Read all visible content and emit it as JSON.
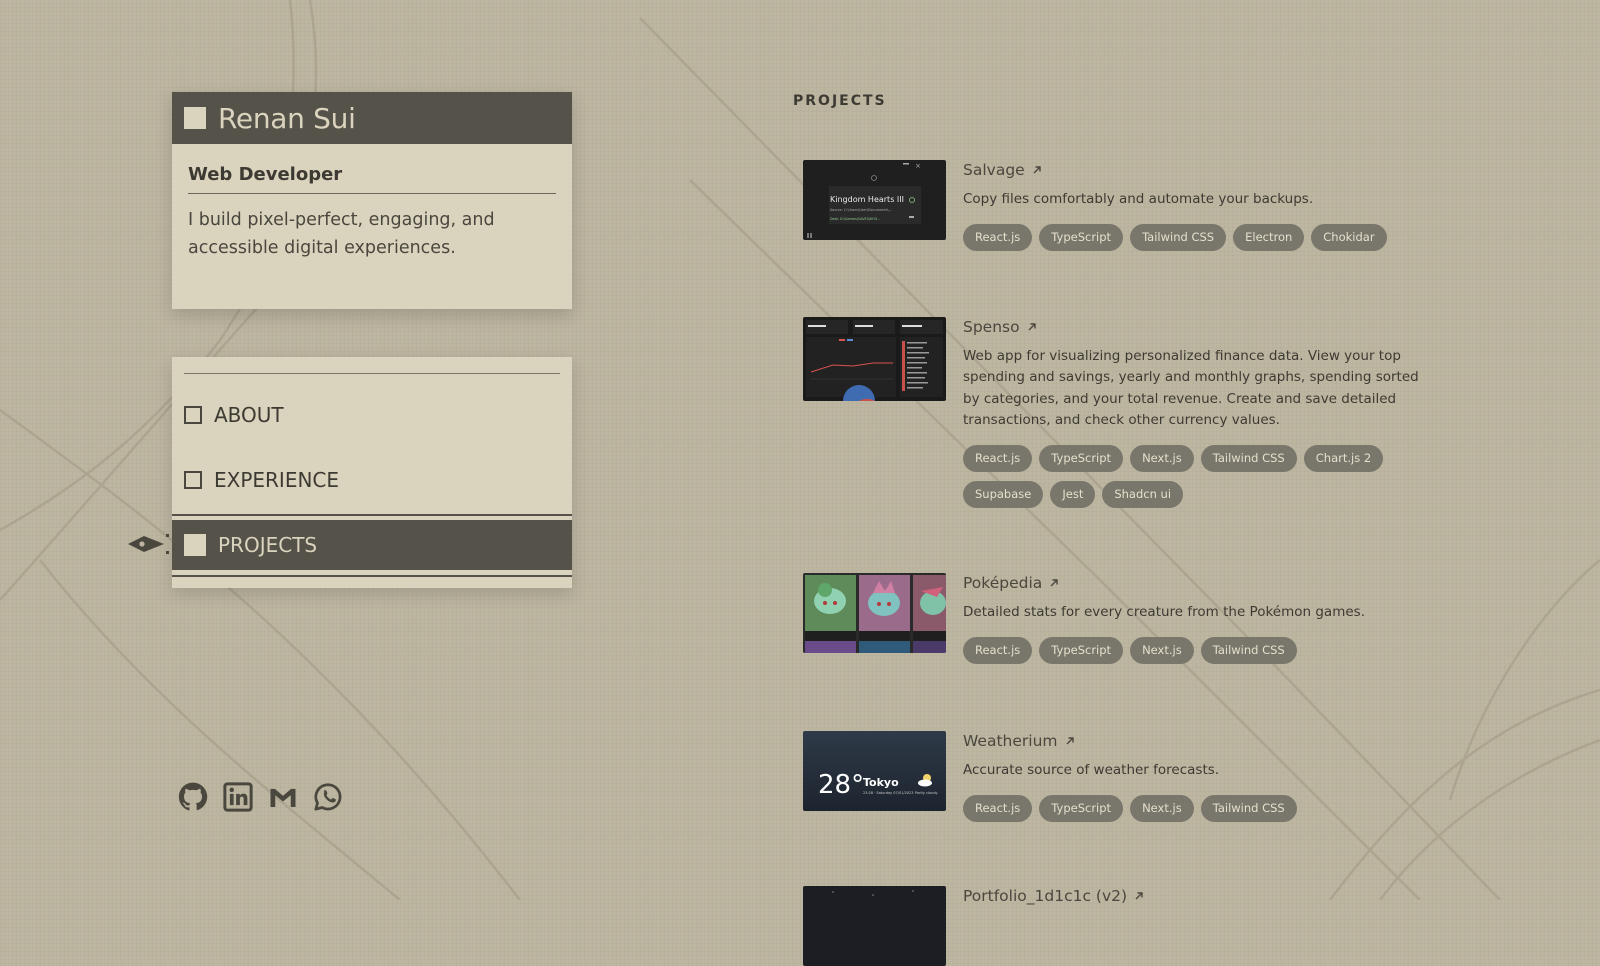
{
  "profile": {
    "name": "Renan Sui",
    "role": "Web Developer",
    "description": "I build pixel-perfect, engaging, and accessible digital experiences."
  },
  "nav": {
    "items": [
      {
        "label": "ABOUT",
        "active": false
      },
      {
        "label": "EXPERIENCE",
        "active": false
      },
      {
        "label": "PROJECTS",
        "active": true
      }
    ]
  },
  "social": [
    "github-icon",
    "linkedin-icon",
    "gmail-icon",
    "whatsapp-icon"
  ],
  "projects_section": {
    "title": "PROJECTS",
    "projects": [
      {
        "title": "Salvage",
        "description": "Copy files comfortably and automate your backups.",
        "tags": [
          "React.js",
          "TypeScript",
          "Tailwind CSS",
          "Electron",
          "Chokidar"
        ],
        "thumb": {
          "game": "Kingdom Hearts III",
          "source": "Source: C:\\Users\\User\\Documents\\...",
          "dest": "Dest: D:\\Games\\SAVES\\KH3..."
        }
      },
      {
        "title": "Spenso",
        "description": "Web app for visualizing personalized finance data. View your top spending and savings, yearly and monthly graphs, spending sorted by categories, and your total revenue. Create and save detailed transactions, and check other currency values.",
        "tags": [
          "React.js",
          "TypeScript",
          "Next.js",
          "Tailwind CSS",
          "Chart.js 2",
          "Supabase",
          "Jest",
          "Shadcn ui"
        ]
      },
      {
        "title": "Poképedia",
        "description": "Detailed stats for every creature from the Pokémon games.",
        "tags": [
          "React.js",
          "TypeScript",
          "Next.js",
          "Tailwind CSS"
        ]
      },
      {
        "title": "Weatherium",
        "description": "Accurate source of weather forecasts.",
        "tags": [
          "React.js",
          "TypeScript",
          "Next.js",
          "Tailwind CSS"
        ],
        "thumb": {
          "temp": "28°",
          "city": "Tokyo",
          "date": "23:28 · Saturday 07/01/2023",
          "condition": "Partly cloudy"
        }
      },
      {
        "title": "Portfolio_1d1c1c (v2)",
        "description": "",
        "tags": []
      }
    ]
  },
  "colors": {
    "background": "#bdb6a1",
    "panel": "#dad3bd",
    "dark": "#55524a",
    "tag_bg": "#79766b",
    "tag_text": "#e6e0cc"
  }
}
